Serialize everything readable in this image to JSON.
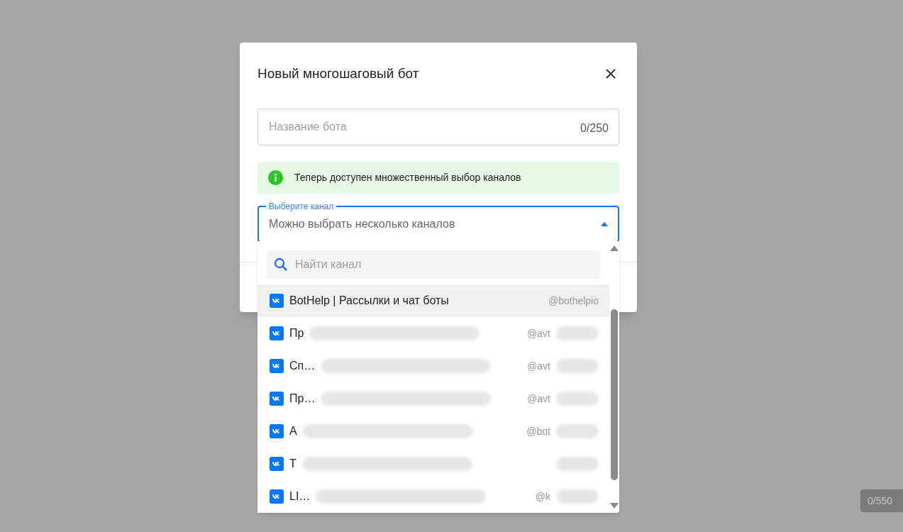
{
  "dialog": {
    "title": "Новый многошаговый бот",
    "name_field": {
      "placeholder": "Название бота",
      "counter": "0/250"
    },
    "notice": "Теперь доступен множественный выбор каналов",
    "channel_select": {
      "label": "Выберите канал",
      "placeholder": "Можно выбрать несколько каналов",
      "expanded": true
    }
  },
  "dropdown": {
    "search": {
      "placeholder": "Найти канал"
    },
    "items": [
      {
        "name": "BotHelp | Рассылки и чат боты",
        "handle": "@bothelpio",
        "blurred": false,
        "selected": true
      },
      {
        "name": "Пр",
        "handle": "@avt",
        "blurred": true,
        "selected": false
      },
      {
        "name": "Сп…",
        "handle": "@avt",
        "blurred": true,
        "selected": false
      },
      {
        "name": "Пр…",
        "handle": "@avt",
        "blurred": true,
        "selected": false
      },
      {
        "name": "А",
        "handle": "@bot",
        "blurred": true,
        "selected": false
      },
      {
        "name": "Т",
        "blurred": true,
        "selected": false
      },
      {
        "name": "LI…",
        "handle": "@k",
        "blurred": true,
        "selected": false
      }
    ]
  },
  "counter_badge": "0/550"
}
